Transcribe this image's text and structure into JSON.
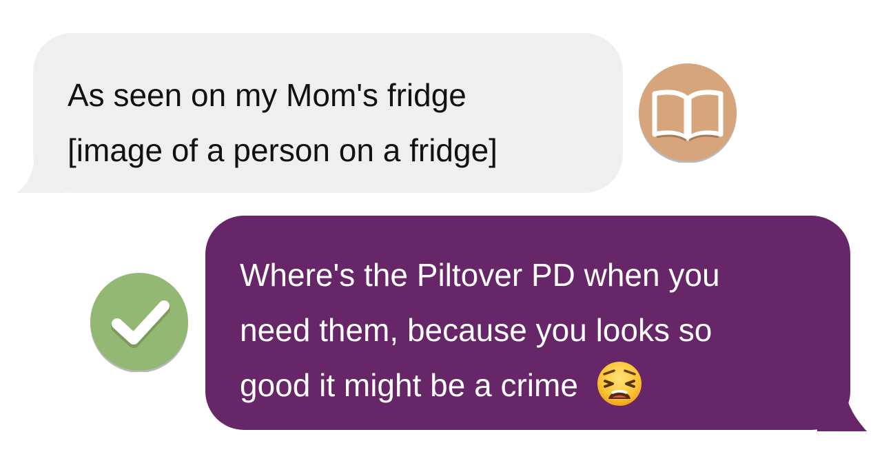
{
  "conversation": {
    "messages": [
      {
        "direction": "incoming",
        "lines": [
          "As seen on my Mom's fridge",
          "[image of a person on a fridge]"
        ],
        "avatar_icon": "open-book-icon",
        "bubble_color": "#efefef",
        "avatar_color": "#d6a57c"
      },
      {
        "direction": "outgoing",
        "lines": [
          "Where's the Piltover PD when you",
          "need them, because you looks so",
          "good it might be a crime"
        ],
        "emoji": "weary-face-emoji",
        "avatar_icon": "checkmark-icon",
        "bubble_color": "#672667",
        "avatar_color": "#93b874"
      }
    ]
  }
}
